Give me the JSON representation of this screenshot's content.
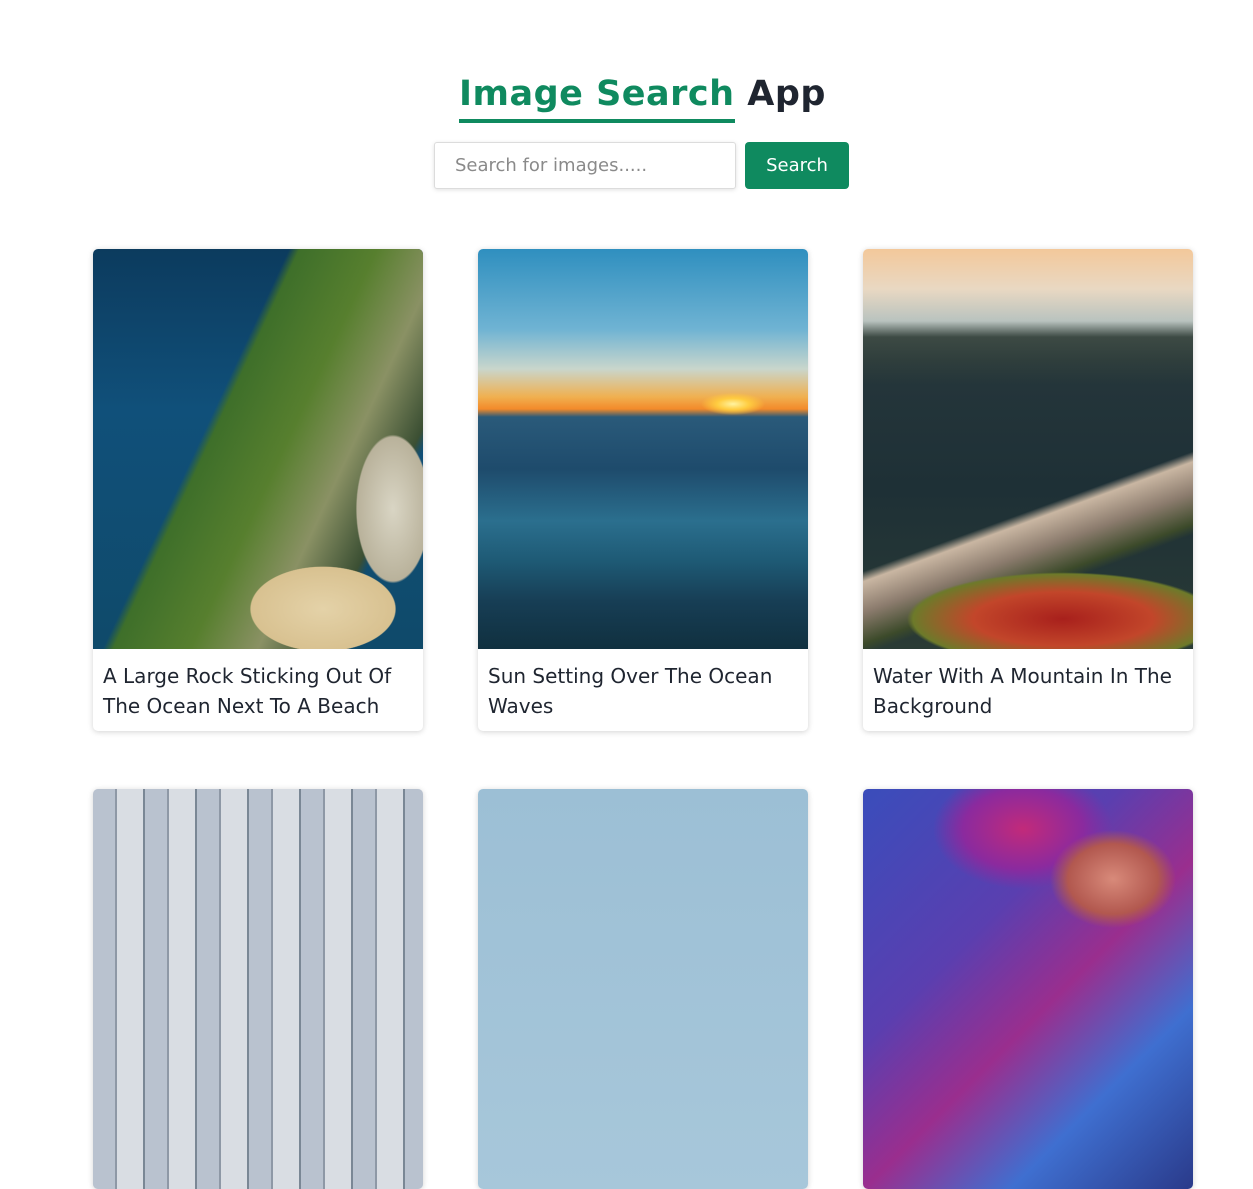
{
  "header": {
    "title_accent": "Image Search",
    "title_plain": "App"
  },
  "search": {
    "placeholder": "Search for images.....",
    "value": "",
    "button_label": "Search"
  },
  "results": [
    {
      "caption": "A Large Rock Sticking Out Of The Ocean Next To A Beach",
      "scene": "cliff"
    },
    {
      "caption": "Sun Setting Over The Ocean Waves",
      "scene": "sunset"
    },
    {
      "caption": "Water With A Mountain In The Background",
      "scene": "lake"
    },
    {
      "caption": "",
      "scene": "city"
    },
    {
      "caption": "",
      "scene": "sky"
    },
    {
      "caption": "",
      "scene": "neon"
    }
  ],
  "colors": {
    "accent": "#0f8a5f",
    "text": "#1f2530"
  }
}
